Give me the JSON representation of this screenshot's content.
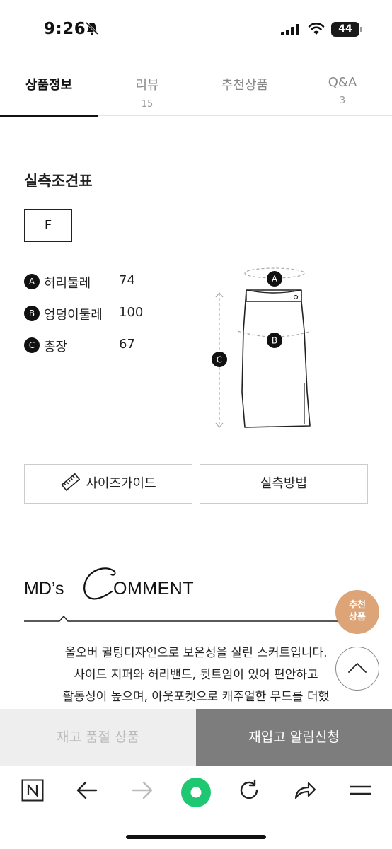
{
  "status_bar": {
    "time": "9:26",
    "battery": "44"
  },
  "tabs": [
    {
      "label": "상품정보",
      "count": ""
    },
    {
      "label": "리뷰",
      "count": "15"
    },
    {
      "label": "추천상품",
      "count": ""
    },
    {
      "label": "Q&A",
      "count": "3"
    }
  ],
  "size_chart": {
    "title": "실측조견표",
    "size": "F",
    "measurements": [
      {
        "badge": "A",
        "name": "허리둘레",
        "value": "74"
      },
      {
        "badge": "B",
        "name": "엉덩이둘레",
        "value": "100"
      },
      {
        "badge": "C",
        "name": "총장",
        "value": "67"
      }
    ],
    "diagram_labels": [
      "A",
      "B",
      "C"
    ]
  },
  "buttons": {
    "size_guide": "사이즈가이드",
    "measure_method": "실측방법"
  },
  "comment": {
    "md": "MD’s",
    "c": "C",
    "omment": "OMMENT",
    "lines": [
      "올오버 퀼팅디자인으로 보온성을 살린 스커트입니다.",
      "사이드 지퍼와 허리밴드, 뒷트임이 있어 편안하고",
      "활동성이 높으며, 아웃포켓으로 캐주얼한 무드를 더했"
    ]
  },
  "fab": {
    "reco_line1": "추천",
    "reco_line2": "상품"
  },
  "bottom": {
    "soldout": "재고 품절 상품",
    "restock": "재입고 알림신청"
  },
  "colors": {
    "accent": "#dca477",
    "restock_bg": "#7d7d7d",
    "soldout_bg": "#eeeeee",
    "nav_green": "#1ec872"
  },
  "icons": [
    "bell-slash-icon",
    "signal-icon",
    "wifi-icon",
    "battery-icon",
    "ruler-icon",
    "chevron-up-icon",
    "naver-n-icon",
    "back-arrow-icon",
    "forward-arrow-icon",
    "green-dot-icon",
    "reload-icon",
    "share-icon",
    "menu-icon"
  ]
}
